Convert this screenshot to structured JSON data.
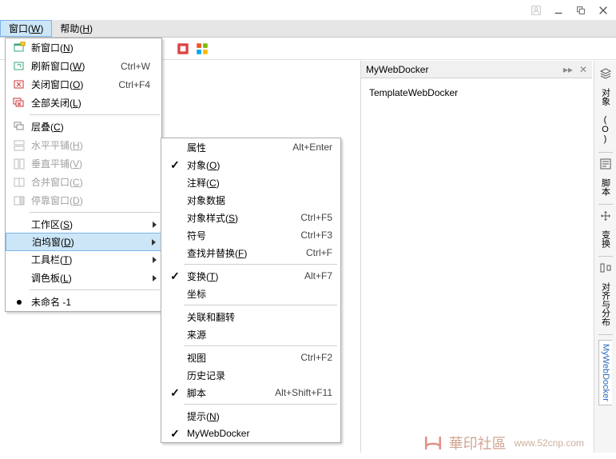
{
  "menubar": {
    "window": {
      "text": "窗口",
      "mnemonic": "W"
    },
    "help": {
      "text": "帮助",
      "mnemonic": "H"
    }
  },
  "dropdown": {
    "new_window": {
      "text": "新窗口",
      "mnemonic": "N"
    },
    "refresh_window": {
      "text": "刷新窗口",
      "mnemonic": "W",
      "accel": "Ctrl+W"
    },
    "close_window": {
      "text": "关闭窗口",
      "mnemonic": "O",
      "accel": "Ctrl+F4"
    },
    "close_all": {
      "text": "全部关闭",
      "mnemonic": "L"
    },
    "cascade": {
      "text": "层叠",
      "mnemonic": "C"
    },
    "tile_h": {
      "text": "水平平铺",
      "mnemonic": "H"
    },
    "tile_v": {
      "text": "垂直平铺",
      "mnemonic": "V"
    },
    "combine": {
      "text": "合并窗口",
      "mnemonic": "C"
    },
    "dock_window": {
      "text": "停靠窗口",
      "mnemonic": "D"
    },
    "workspace": {
      "text": "工作区",
      "mnemonic": "S"
    },
    "dockers": {
      "text": "泊坞窗",
      "mnemonic": "D"
    },
    "toolbars": {
      "text": "工具栏",
      "mnemonic": "T"
    },
    "palette": {
      "text": "调色板",
      "mnemonic": "L"
    },
    "doc1": "未命名 -1"
  },
  "submenu": {
    "properties": {
      "text": "属性",
      "accel": "Alt+Enter"
    },
    "object": {
      "text": "对象",
      "mnemonic": "O"
    },
    "comment": {
      "text": "注释",
      "mnemonic": "C"
    },
    "object_data": {
      "text": "对象数据"
    },
    "object_style": {
      "text": "对象样式",
      "mnemonic": "S",
      "accel": "Ctrl+F5"
    },
    "symbol": {
      "text": "符号",
      "accel": "Ctrl+F3"
    },
    "find_replace": {
      "text": "查找并替换",
      "mnemonic": "F",
      "accel": "Ctrl+F"
    },
    "transform": {
      "text": "变换",
      "mnemonic": "T",
      "accel": "Alt+F7"
    },
    "coords": {
      "text": "坐标"
    },
    "assoc_flip": {
      "text": "关联和翻转"
    },
    "source": {
      "text": "来源"
    },
    "view": {
      "text": "视图",
      "accel": "Ctrl+F2"
    },
    "history": {
      "text": "历史记录"
    },
    "script": {
      "text": "脚本",
      "accel": "Alt+Shift+F11"
    },
    "hint": {
      "text": "提示",
      "mnemonic": "N"
    },
    "mywebdocker": {
      "text": "MyWebDocker"
    }
  },
  "panel": {
    "title": "MyWebDocker",
    "items": [
      "TemplateWebDocker"
    ]
  },
  "sidetabs": {
    "objects": "对象 (O)",
    "script": "脚本",
    "transform": "变换",
    "align": "对齐与分布",
    "mywebdocker": "MyWebDocker"
  },
  "watermark": {
    "text": "華印社區",
    "url": "www.52cnp.com"
  }
}
